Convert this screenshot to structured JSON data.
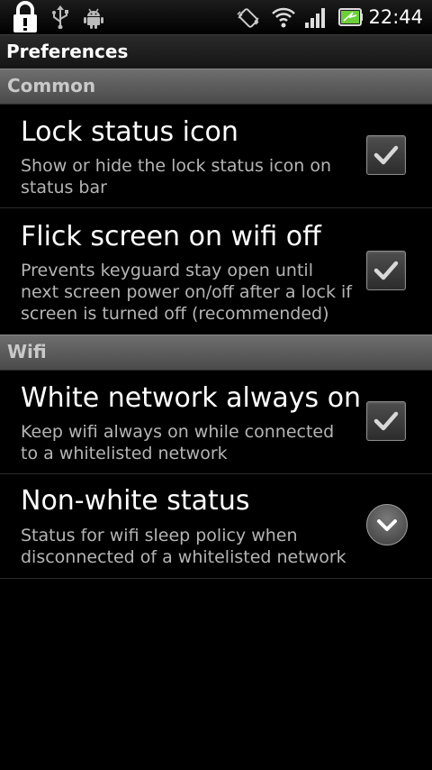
{
  "status_bar": {
    "time": "22:44",
    "icons": [
      "lock-icon",
      "usb-icon",
      "android-icon",
      "vibrate-icon",
      "wifi-icon",
      "signal-icon",
      "battery-icon"
    ]
  },
  "title_bar": {
    "title": "Preferences"
  },
  "categories": [
    {
      "label": "Common",
      "prefs": [
        {
          "title": "Lock status icon",
          "summary": "Show or hide the lock status icon on status bar",
          "widget": "checkbox",
          "checked": true
        },
        {
          "title": "Flick screen on wifi off",
          "summary": "Prevents keyguard stay open until next screen power on/off after a lock if screen is turned off (recommended)",
          "widget": "checkbox",
          "checked": true
        }
      ]
    },
    {
      "label": "Wifi",
      "prefs": [
        {
          "title": "White network always on",
          "summary": "Keep wifi always on while connected to a whitelisted network",
          "widget": "checkbox",
          "checked": true
        },
        {
          "title": "Non-white status",
          "summary": "Status for wifi sleep policy when disconnected of a whitelisted network",
          "widget": "dropdown"
        }
      ]
    }
  ],
  "colors": {
    "background": "#000000",
    "title_text": "#ffffff",
    "summary_text": "#b5b5b5",
    "category_text": "#c9c9c9",
    "battery_fill": "#6fcf3a"
  }
}
